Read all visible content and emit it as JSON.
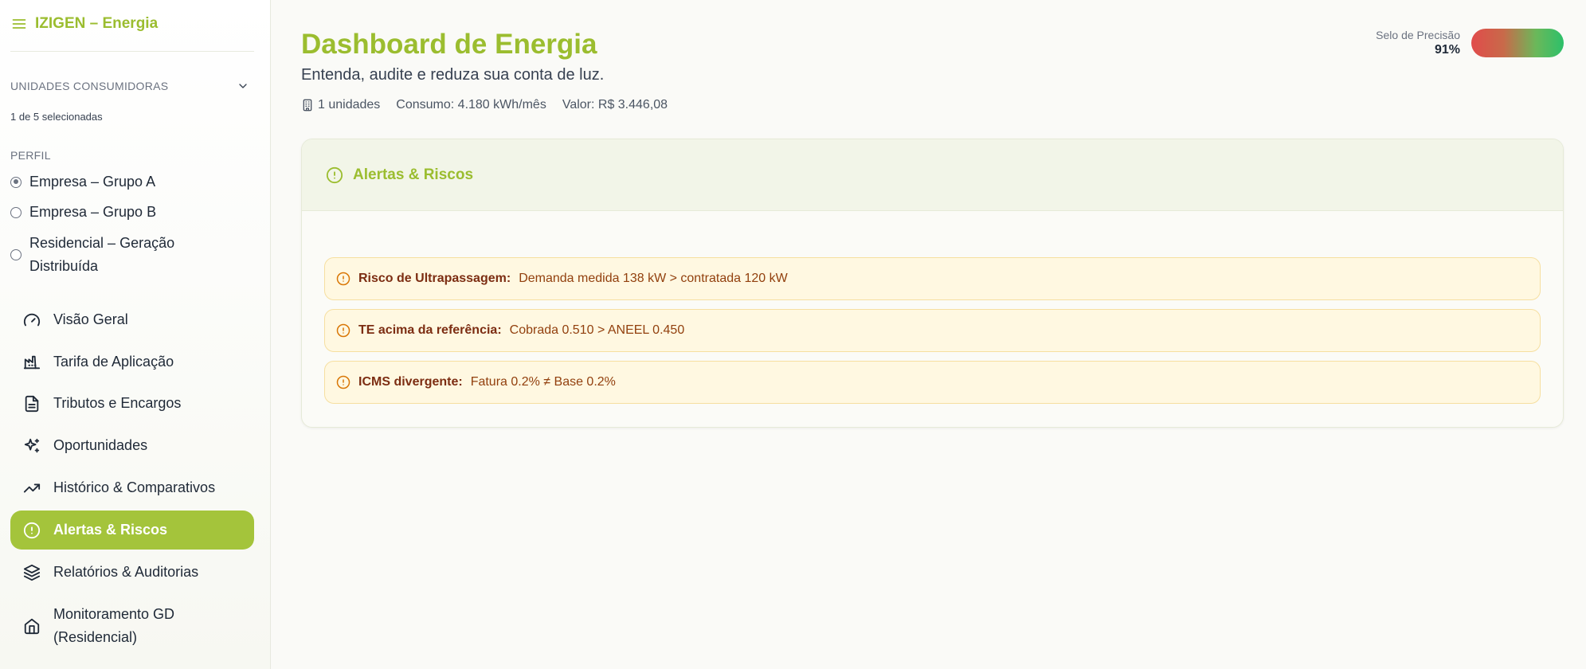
{
  "app": {
    "brand": "IZIGEN – Energia"
  },
  "sidebar": {
    "units_label": "UNIDADES CONSUMIDORAS",
    "units_count": "1 de 5 selecionadas",
    "profile_label": "PERFIL",
    "profiles": [
      {
        "label": "Empresa – Grupo A",
        "checked": true
      },
      {
        "label": "Empresa – Grupo B",
        "checked": false
      },
      {
        "label": "Residencial – Geração Distribuída",
        "checked": false
      }
    ],
    "nav": [
      {
        "label": "Visão Geral",
        "icon": "gauge-icon"
      },
      {
        "label": "Tarifa de Aplicação",
        "icon": "factory-icon"
      },
      {
        "label": "Tributos e Encargos",
        "icon": "document-icon"
      },
      {
        "label": "Oportunidades",
        "icon": "sparkles-icon"
      },
      {
        "label": "Histórico & Comparativos",
        "icon": "trending-up-icon"
      },
      {
        "label": "Alertas & Riscos",
        "icon": "alert-circle-icon",
        "active": true
      },
      {
        "label": "Relatórios & Auditorias",
        "icon": "layers-icon"
      },
      {
        "label": "Monitoramento GD (Residencial)",
        "icon": "home-icon"
      }
    ]
  },
  "header": {
    "title": "Dashboard de Energia",
    "subtitle": "Entenda, audite e reduza sua conta de luz.",
    "meta": {
      "units": "1 unidades",
      "consumption": "Consumo: 4.180 kWh/mês",
      "value": "Valor: R$ 3.446,08"
    },
    "precision": {
      "label": "Selo de Precisão",
      "value": "91%",
      "fraction": 0.91
    }
  },
  "panel": {
    "title": "Alertas & Riscos",
    "alerts": [
      {
        "title": "Risco de Ultrapassagem:",
        "text": "Demanda medida 138 kW > contratada 120 kW"
      },
      {
        "title": "TE acima da referência:",
        "text": "Cobrada 0.510 > ANEEL 0.450"
      },
      {
        "title": "ICMS divergente:",
        "text": "Fatura 0.2% ≠ Base 0.2%"
      }
    ]
  },
  "colors": {
    "brand": "#9bbd2f",
    "active_nav": "#a4c43b",
    "alert_bg": "#fff8e1",
    "alert_text": "#92400e"
  }
}
